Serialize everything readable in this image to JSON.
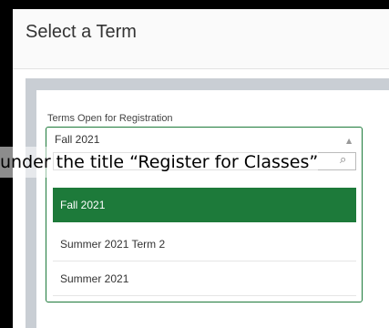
{
  "header": {
    "title": "Select a Term"
  },
  "form": {
    "label": "Terms Open for Registration",
    "selected": "Fall 2021",
    "options": [
      "Fall 2021",
      "Summer 2021 Term 2",
      "Summer 2021"
    ]
  },
  "overlay": {
    "text": "under the title “Register for Classes”"
  },
  "colors": {
    "accent": "#1d7a3a",
    "frame": "#c9ced4"
  }
}
